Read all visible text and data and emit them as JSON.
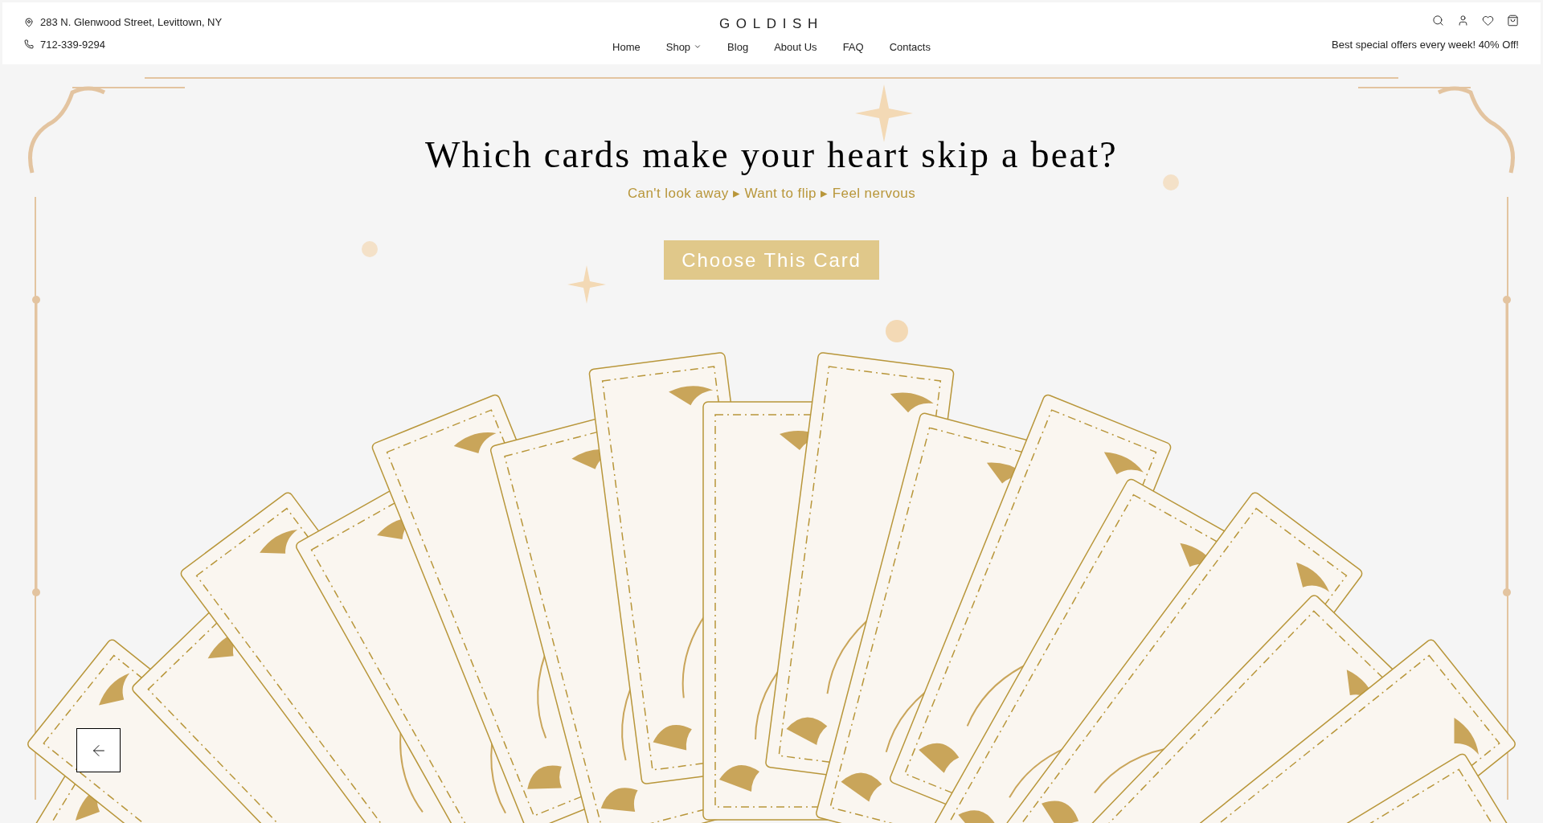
{
  "header": {
    "address": "283 N. Glenwood Street, Levittown, NY",
    "phone": "712-339-9294",
    "logo": "GOLDISH",
    "nav": [
      {
        "label": "Home",
        "dropdown": false
      },
      {
        "label": "Shop",
        "dropdown": true
      },
      {
        "label": "Blog",
        "dropdown": false
      },
      {
        "label": "About Us",
        "dropdown": false
      },
      {
        "label": "FAQ",
        "dropdown": false
      },
      {
        "label": "Contacts",
        "dropdown": false
      }
    ],
    "promo": "Best special offers every week! 40% Off!"
  },
  "hero": {
    "title": "Which cards make your heart skip a beat?",
    "subtitle": "Can't look away ▸ Want to flip ▸ Feel nervous",
    "button": "Choose This Card"
  }
}
